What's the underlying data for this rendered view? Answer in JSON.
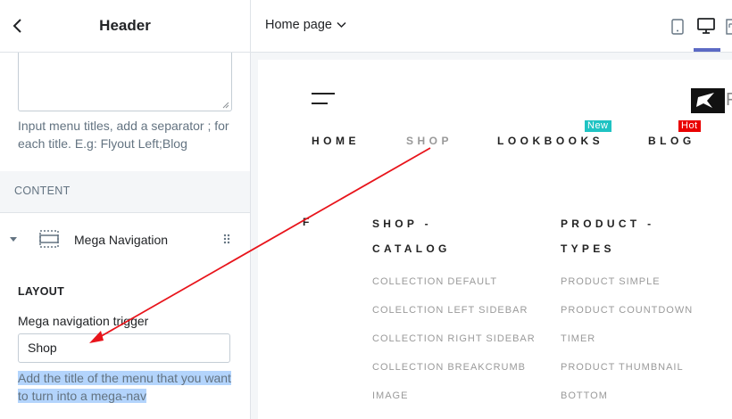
{
  "sidebar": {
    "title": "Header",
    "upper_help": "Input menu titles, add a separator ; for each title. E.g: Flyout Left;Blog",
    "content_section": "CONTENT",
    "block": {
      "label": "Mega Navigation"
    },
    "layout_section": "LAYOUT",
    "trigger_label": "Mega navigation trigger",
    "trigger_value": "Shop",
    "trigger_help": "Add the title of the menu that you want to turn into a mega-nav"
  },
  "topbar": {
    "page_select": "Home page",
    "selected_view": "desktop"
  },
  "preview": {
    "logo_letter": "F",
    "nav": [
      {
        "label": "HOME"
      },
      {
        "label": "SHOP",
        "state": "hover"
      },
      {
        "label": "LOOKBOOKS",
        "badge": "New"
      },
      {
        "label": "BLOG",
        "badge": "Hot"
      }
    ],
    "mega_menu": {
      "first_letter": "F",
      "columns": [
        {
          "heading_line1": "SHOP -",
          "heading_line2": "CATALOG",
          "links": [
            "COLLECTION DEFAULT",
            "COLELCTION LEFT SIDEBAR",
            "COLLECTION RIGHT SIDEBAR",
            "COLLECTION BREAKCRUMB",
            "IMAGE"
          ]
        },
        {
          "heading_line1": "PRODUCT -",
          "heading_line2": "TYPES",
          "links": [
            "PRODUCT SIMPLE",
            "PRODUCT COUNTDOWN",
            "TIMER",
            "PRODUCT THUMBNAIL",
            "BOTTOM"
          ]
        }
      ]
    }
  },
  "colors": {
    "accent": "#5c6ac4",
    "badge_new": "#1fc3c3",
    "badge_hot": "#e90000",
    "annotation_arrow": "#e8141b",
    "selection_highlight": "#b3d4fc"
  }
}
